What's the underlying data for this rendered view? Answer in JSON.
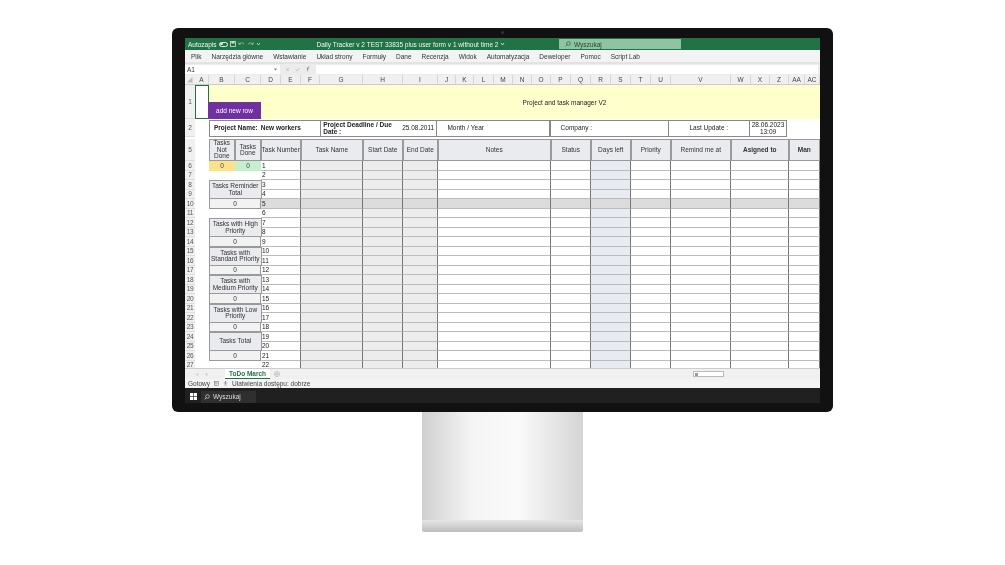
{
  "titlebar": {
    "autosave_label": "Autozapis",
    "autosave_on": false,
    "title": "Daily Tracker v 2 TEST 33835 plus user form v 1 without time 2",
    "search_placeholder": "Wyszukaj"
  },
  "menu": [
    "Plik",
    "Narzędzia główne",
    "Wstawianie",
    "Układ strony",
    "Formuły",
    "Dane",
    "Recenzja",
    "Widok",
    "Automatyzacja",
    "Deweloper",
    "Pomoc",
    "Script Lab"
  ],
  "formula_bar": {
    "name_box": "A1"
  },
  "columns": [
    "A",
    "B",
    "C",
    "D",
    "E",
    "F",
    "G",
    "H",
    "I",
    "J",
    "K",
    "L",
    "M",
    "N",
    "O",
    "P",
    "Q",
    "R",
    "S",
    "T",
    "U",
    "V",
    "W",
    "X",
    "Z",
    "AA",
    "AC"
  ],
  "sheet": {
    "row_labels": [
      "1",
      "2",
      "5"
    ],
    "title": "Project and task manager V2",
    "add_row_button": "add new row",
    "info": [
      {
        "label": "Project Name:",
        "value": "New workers"
      },
      {
        "label": "Project Deadline / Due Date :",
        "value": "25.08.2011"
      },
      {
        "label": "Month / Year"
      },
      {
        "label": "Company :"
      },
      {
        "label": "Last Update :"
      },
      {
        "value": "28.06.2023 13:09"
      }
    ],
    "counters": [
      {
        "label": "Tasks Not Done",
        "value": "0",
        "color": "#fce38a"
      },
      {
        "label": "Tasks Done",
        "value": "0",
        "color": "#c6efce"
      }
    ],
    "headers": [
      {
        "label": "Task Number",
        "bold": false,
        "kind": "plain"
      },
      {
        "label": "Task Name",
        "bold": false,
        "kind": "shaded"
      },
      {
        "label": "Start Date",
        "bold": false,
        "kind": "shaded"
      },
      {
        "label": "End Date",
        "bold": false,
        "kind": "shaded"
      },
      {
        "label": "Notes",
        "bold": false,
        "kind": "plain"
      },
      {
        "label": "Status",
        "bold": false,
        "kind": "plain"
      },
      {
        "label": "Days left",
        "bold": false,
        "kind": "tinted"
      },
      {
        "label": "Priority",
        "bold": false,
        "kind": "plain"
      },
      {
        "label": "Remind me at",
        "bold": false,
        "kind": "plain"
      },
      {
        "label": "Asigned to",
        "bold": true,
        "kind": "plain"
      },
      {
        "label": "Man",
        "bold": true,
        "kind": "plain"
      }
    ],
    "summary": [
      {
        "label": "Tasks Reminder Total",
        "value": "0"
      },
      {
        "label": "Tasks with High Priority",
        "value": "0"
      },
      {
        "label": "Tasks with Standard Priority",
        "value": "0"
      },
      {
        "label": "Tasks with Medium Priority",
        "value": "0"
      },
      {
        "label": "Tasks with Low Priority",
        "value": "0"
      },
      {
        "label": "Tasks Total",
        "value": "0"
      }
    ],
    "rows": [
      {
        "row": "6",
        "task": "1",
        "shaded": false
      },
      {
        "row": "7",
        "task": "2",
        "shaded": false
      },
      {
        "row": "8",
        "task": "3",
        "shaded": false
      },
      {
        "row": "9",
        "task": "4",
        "shaded": false
      },
      {
        "row": "10",
        "task": "5",
        "shaded": true
      },
      {
        "row": "11",
        "task": "6",
        "shaded": false
      },
      {
        "row": "12",
        "task": "7",
        "shaded": false
      },
      {
        "row": "13",
        "task": "8",
        "shaded": false
      },
      {
        "row": "14",
        "task": "9",
        "shaded": false
      },
      {
        "row": "15",
        "task": "10",
        "shaded": false
      },
      {
        "row": "16",
        "task": "11",
        "shaded": false
      },
      {
        "row": "17",
        "task": "12",
        "shaded": false
      },
      {
        "row": "18",
        "task": "13",
        "shaded": false
      },
      {
        "row": "19",
        "task": "14",
        "shaded": false
      },
      {
        "row": "20",
        "task": "15",
        "shaded": false
      },
      {
        "row": "21",
        "task": "16",
        "shaded": false
      },
      {
        "row": "22",
        "task": "17",
        "shaded": false
      },
      {
        "row": "23",
        "task": "18",
        "shaded": false
      },
      {
        "row": "24",
        "task": "19",
        "shaded": false
      },
      {
        "row": "25",
        "task": "20",
        "shaded": false
      },
      {
        "row": "26",
        "task": "21",
        "shaded": false
      },
      {
        "row": "27",
        "task": "22",
        "shaded": false
      }
    ]
  },
  "sheet_tabs": [
    {
      "label": "ToDo March",
      "selected": true
    }
  ],
  "status_bar": {
    "ready": "Gotowy",
    "accessibility": "Ułatwienia dostępu: dobrze"
  },
  "taskbar": {
    "search_placeholder": "Wyszukaj"
  }
}
